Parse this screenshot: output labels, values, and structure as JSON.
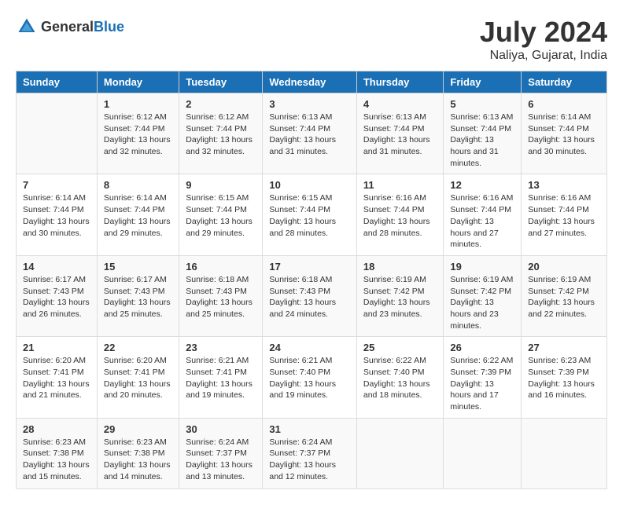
{
  "logo": {
    "general": "General",
    "blue": "Blue"
  },
  "title": "July 2024",
  "location": "Naliya, Gujarat, India",
  "days": [
    "Sunday",
    "Monday",
    "Tuesday",
    "Wednesday",
    "Thursday",
    "Friday",
    "Saturday"
  ],
  "weeks": [
    [
      {
        "date": "",
        "sunrise": "",
        "sunset": "",
        "daylight": ""
      },
      {
        "date": "1",
        "sunrise": "Sunrise: 6:12 AM",
        "sunset": "Sunset: 7:44 PM",
        "daylight": "Daylight: 13 hours and 32 minutes."
      },
      {
        "date": "2",
        "sunrise": "Sunrise: 6:12 AM",
        "sunset": "Sunset: 7:44 PM",
        "daylight": "Daylight: 13 hours and 32 minutes."
      },
      {
        "date": "3",
        "sunrise": "Sunrise: 6:13 AM",
        "sunset": "Sunset: 7:44 PM",
        "daylight": "Daylight: 13 hours and 31 minutes."
      },
      {
        "date": "4",
        "sunrise": "Sunrise: 6:13 AM",
        "sunset": "Sunset: 7:44 PM",
        "daylight": "Daylight: 13 hours and 31 minutes."
      },
      {
        "date": "5",
        "sunrise": "Sunrise: 6:13 AM",
        "sunset": "Sunset: 7:44 PM",
        "daylight": "Daylight: 13 hours and 31 minutes."
      },
      {
        "date": "6",
        "sunrise": "Sunrise: 6:14 AM",
        "sunset": "Sunset: 7:44 PM",
        "daylight": "Daylight: 13 hours and 30 minutes."
      }
    ],
    [
      {
        "date": "7",
        "sunrise": "Sunrise: 6:14 AM",
        "sunset": "Sunset: 7:44 PM",
        "daylight": "Daylight: 13 hours and 30 minutes."
      },
      {
        "date": "8",
        "sunrise": "Sunrise: 6:14 AM",
        "sunset": "Sunset: 7:44 PM",
        "daylight": "Daylight: 13 hours and 29 minutes."
      },
      {
        "date": "9",
        "sunrise": "Sunrise: 6:15 AM",
        "sunset": "Sunset: 7:44 PM",
        "daylight": "Daylight: 13 hours and 29 minutes."
      },
      {
        "date": "10",
        "sunrise": "Sunrise: 6:15 AM",
        "sunset": "Sunset: 7:44 PM",
        "daylight": "Daylight: 13 hours and 28 minutes."
      },
      {
        "date": "11",
        "sunrise": "Sunrise: 6:16 AM",
        "sunset": "Sunset: 7:44 PM",
        "daylight": "Daylight: 13 hours and 28 minutes."
      },
      {
        "date": "12",
        "sunrise": "Sunrise: 6:16 AM",
        "sunset": "Sunset: 7:44 PM",
        "daylight": "Daylight: 13 hours and 27 minutes."
      },
      {
        "date": "13",
        "sunrise": "Sunrise: 6:16 AM",
        "sunset": "Sunset: 7:44 PM",
        "daylight": "Daylight: 13 hours and 27 minutes."
      }
    ],
    [
      {
        "date": "14",
        "sunrise": "Sunrise: 6:17 AM",
        "sunset": "Sunset: 7:43 PM",
        "daylight": "Daylight: 13 hours and 26 minutes."
      },
      {
        "date": "15",
        "sunrise": "Sunrise: 6:17 AM",
        "sunset": "Sunset: 7:43 PM",
        "daylight": "Daylight: 13 hours and 25 minutes."
      },
      {
        "date": "16",
        "sunrise": "Sunrise: 6:18 AM",
        "sunset": "Sunset: 7:43 PM",
        "daylight": "Daylight: 13 hours and 25 minutes."
      },
      {
        "date": "17",
        "sunrise": "Sunrise: 6:18 AM",
        "sunset": "Sunset: 7:43 PM",
        "daylight": "Daylight: 13 hours and 24 minutes."
      },
      {
        "date": "18",
        "sunrise": "Sunrise: 6:19 AM",
        "sunset": "Sunset: 7:42 PM",
        "daylight": "Daylight: 13 hours and 23 minutes."
      },
      {
        "date": "19",
        "sunrise": "Sunrise: 6:19 AM",
        "sunset": "Sunset: 7:42 PM",
        "daylight": "Daylight: 13 hours and 23 minutes."
      },
      {
        "date": "20",
        "sunrise": "Sunrise: 6:19 AM",
        "sunset": "Sunset: 7:42 PM",
        "daylight": "Daylight: 13 hours and 22 minutes."
      }
    ],
    [
      {
        "date": "21",
        "sunrise": "Sunrise: 6:20 AM",
        "sunset": "Sunset: 7:41 PM",
        "daylight": "Daylight: 13 hours and 21 minutes."
      },
      {
        "date": "22",
        "sunrise": "Sunrise: 6:20 AM",
        "sunset": "Sunset: 7:41 PM",
        "daylight": "Daylight: 13 hours and 20 minutes."
      },
      {
        "date": "23",
        "sunrise": "Sunrise: 6:21 AM",
        "sunset": "Sunset: 7:41 PM",
        "daylight": "Daylight: 13 hours and 19 minutes."
      },
      {
        "date": "24",
        "sunrise": "Sunrise: 6:21 AM",
        "sunset": "Sunset: 7:40 PM",
        "daylight": "Daylight: 13 hours and 19 minutes."
      },
      {
        "date": "25",
        "sunrise": "Sunrise: 6:22 AM",
        "sunset": "Sunset: 7:40 PM",
        "daylight": "Daylight: 13 hours and 18 minutes."
      },
      {
        "date": "26",
        "sunrise": "Sunrise: 6:22 AM",
        "sunset": "Sunset: 7:39 PM",
        "daylight": "Daylight: 13 hours and 17 minutes."
      },
      {
        "date": "27",
        "sunrise": "Sunrise: 6:23 AM",
        "sunset": "Sunset: 7:39 PM",
        "daylight": "Daylight: 13 hours and 16 minutes."
      }
    ],
    [
      {
        "date": "28",
        "sunrise": "Sunrise: 6:23 AM",
        "sunset": "Sunset: 7:38 PM",
        "daylight": "Daylight: 13 hours and 15 minutes."
      },
      {
        "date": "29",
        "sunrise": "Sunrise: 6:23 AM",
        "sunset": "Sunset: 7:38 PM",
        "daylight": "Daylight: 13 hours and 14 minutes."
      },
      {
        "date": "30",
        "sunrise": "Sunrise: 6:24 AM",
        "sunset": "Sunset: 7:37 PM",
        "daylight": "Daylight: 13 hours and 13 minutes."
      },
      {
        "date": "31",
        "sunrise": "Sunrise: 6:24 AM",
        "sunset": "Sunset: 7:37 PM",
        "daylight": "Daylight: 13 hours and 12 minutes."
      },
      {
        "date": "",
        "sunrise": "",
        "sunset": "",
        "daylight": ""
      },
      {
        "date": "",
        "sunrise": "",
        "sunset": "",
        "daylight": ""
      },
      {
        "date": "",
        "sunrise": "",
        "sunset": "",
        "daylight": ""
      }
    ]
  ]
}
